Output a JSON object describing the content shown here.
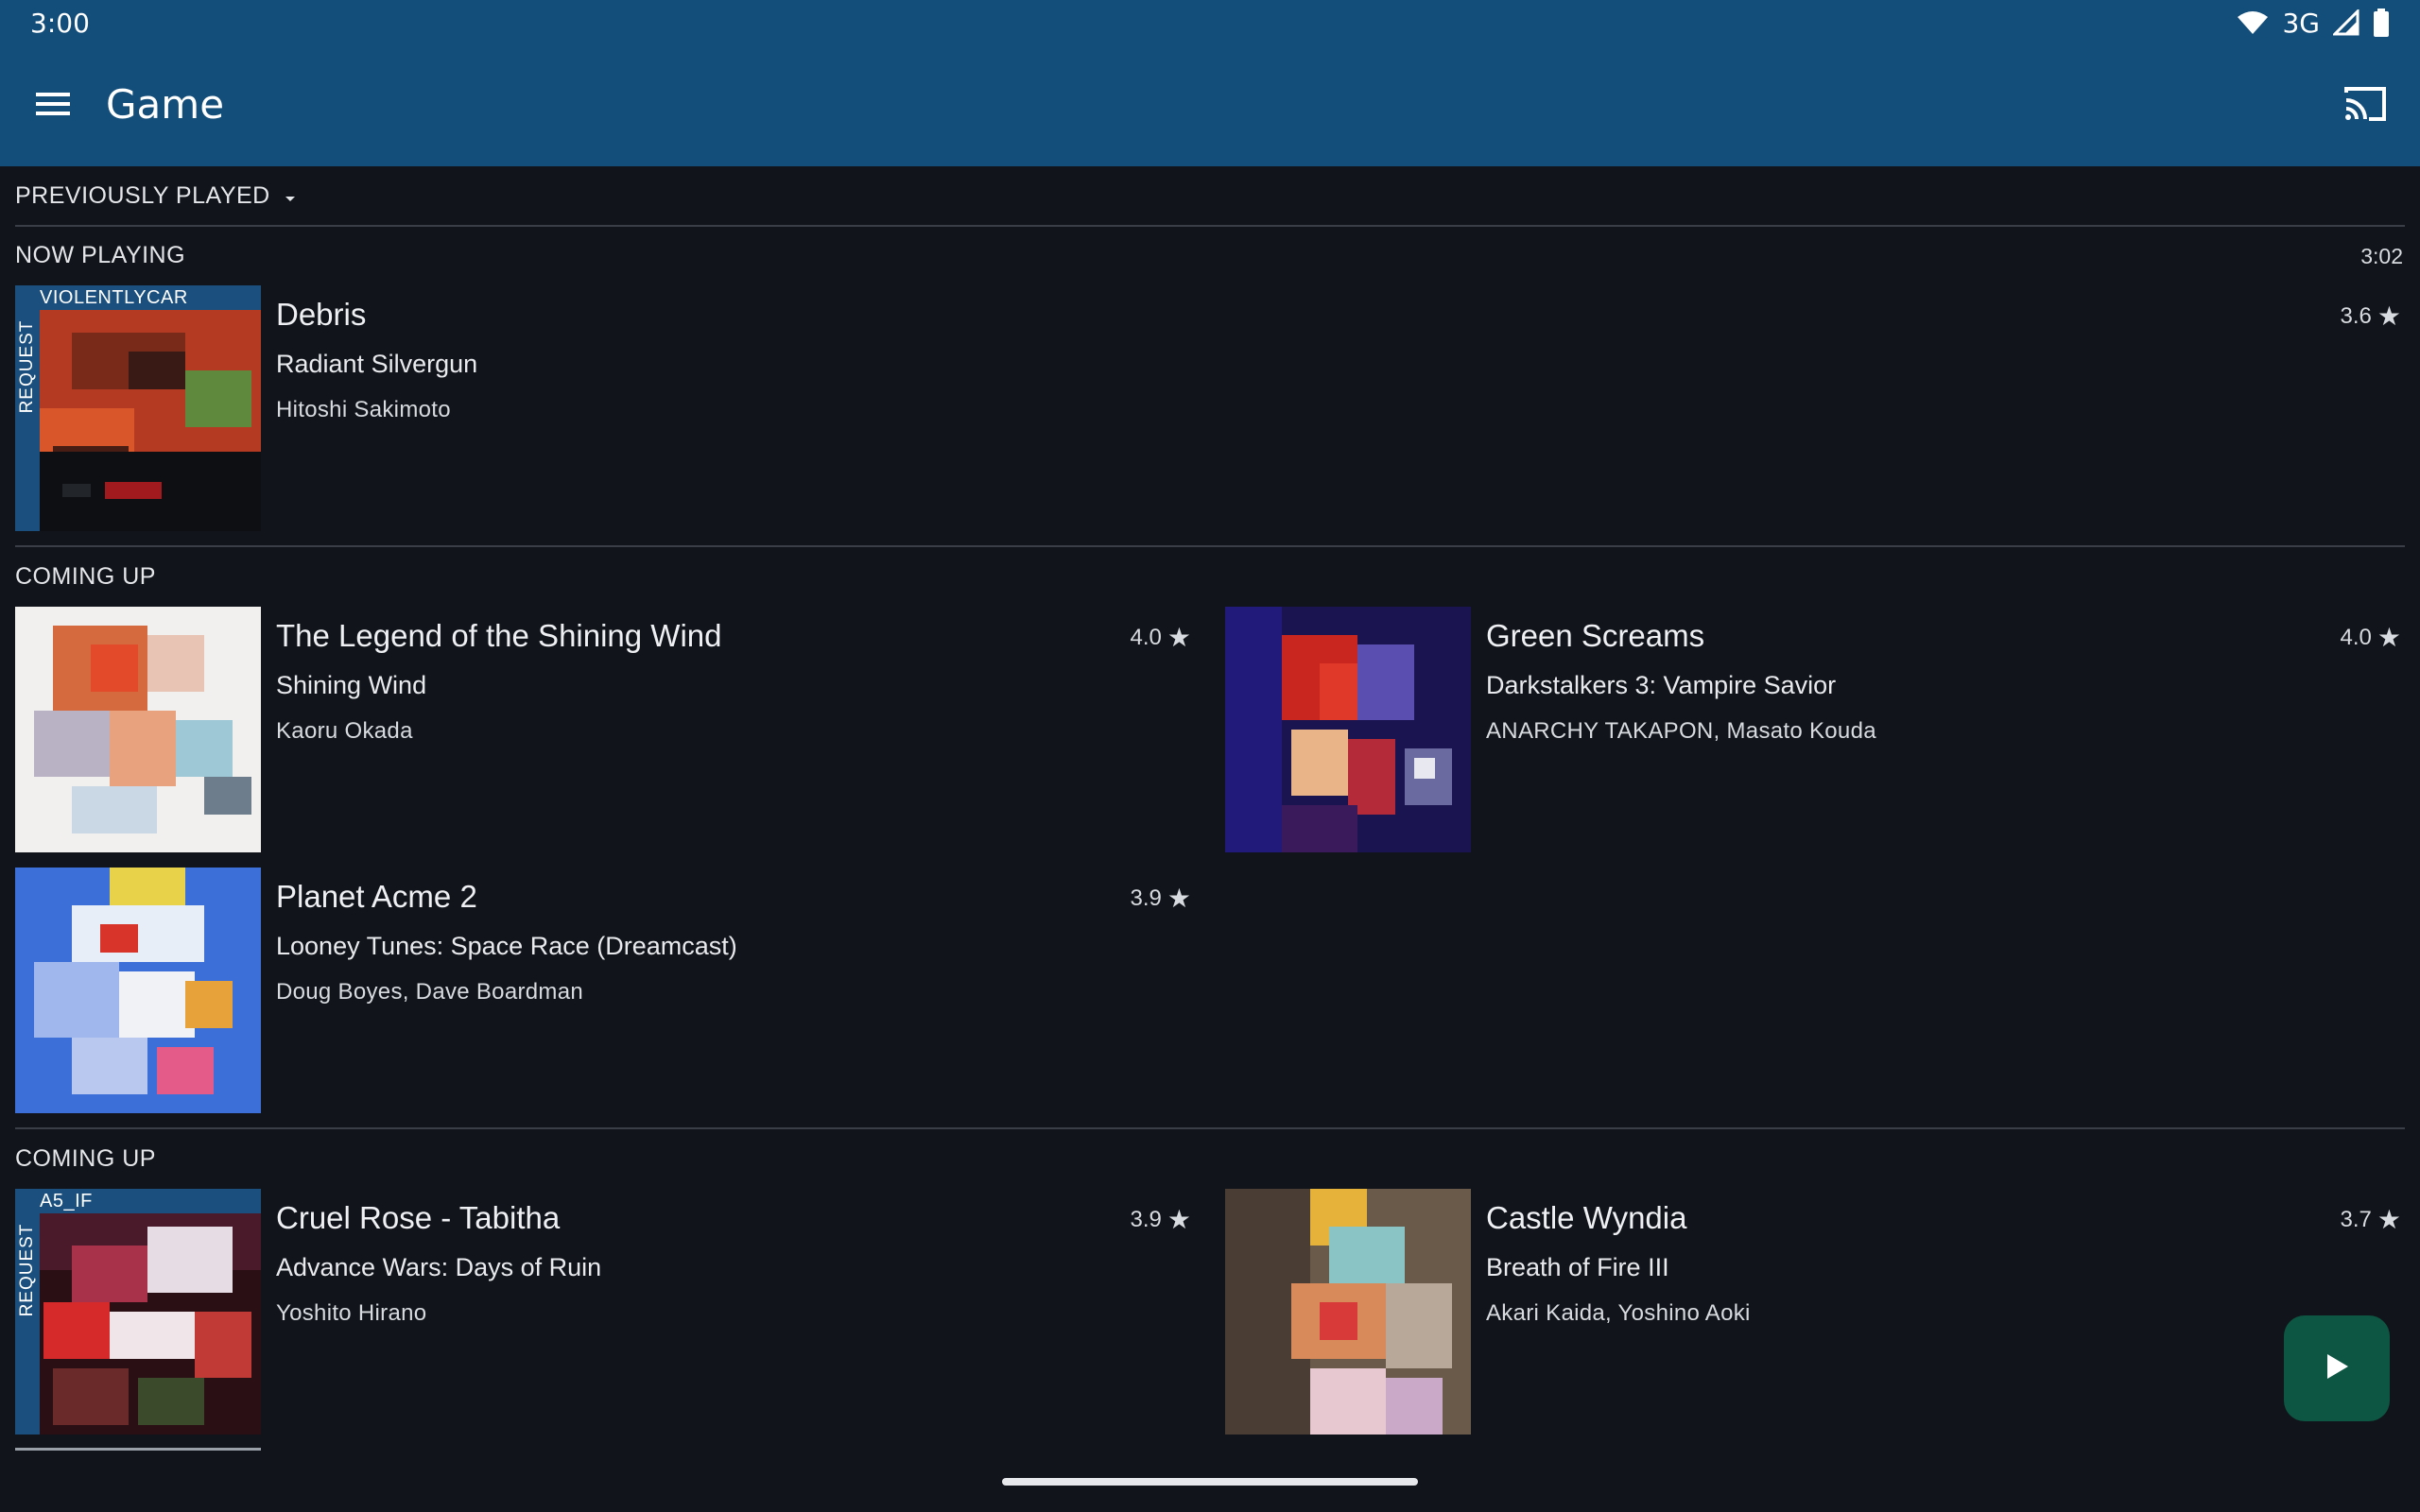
{
  "status_bar": {
    "time": "3:00",
    "network": "3G",
    "icons": [
      "wifi-icon",
      "signal-icon",
      "battery-icon"
    ]
  },
  "app_bar": {
    "title": "Game",
    "menu_icon": "menu-icon",
    "cast_icon": "cast-icon"
  },
  "filter": {
    "label": "PREVIOUSLY PLAYED",
    "icon": "dropdown-arrow-icon"
  },
  "now_playing": {
    "label": "NOW PLAYING",
    "elapsed": "3:02",
    "song": {
      "title": "Debris",
      "album": "Radiant Silvergun",
      "artist": "Hitoshi Sakimoto",
      "rating": "3.6",
      "request_label": "REQUEST",
      "requested_by": "VIOLENTLYCAR"
    }
  },
  "coming_up_1": {
    "label": "COMING UP",
    "songs": [
      {
        "title": "The Legend of the Shining Wind",
        "album": "Shining Wind",
        "artist": "Kaoru Okada",
        "rating": "4.0"
      },
      {
        "title": "Green Screams",
        "album": "Darkstalkers 3: Vampire Savior",
        "artist": "ANARCHY TAKAPON, Masato Kouda",
        "rating": "4.0"
      },
      {
        "title": "Planet Acme 2",
        "album": "Looney Tunes: Space Race (Dreamcast)",
        "artist": "Doug Boyes, Dave Boardman",
        "rating": "3.9"
      }
    ]
  },
  "coming_up_2": {
    "label": "COMING UP",
    "songs": [
      {
        "title": "Cruel Rose - Tabitha",
        "album": "Advance Wars: Days of Ruin",
        "artist": "Yoshito Hirano",
        "rating": "3.9",
        "request_label": "REQUEST",
        "requested_by": "A5_IF"
      },
      {
        "title": "Castle Wyndia",
        "album": "Breath of Fire III",
        "artist": "Akari Kaida, Yoshino Aoki",
        "rating": "3.7"
      }
    ]
  },
  "fab": {
    "icon": "play-icon"
  },
  "star_glyph": "★",
  "colors": {
    "app_bar": "#134d79",
    "background": "#11141a",
    "fab": "#0d5643",
    "request": "#1a4f7e"
  }
}
